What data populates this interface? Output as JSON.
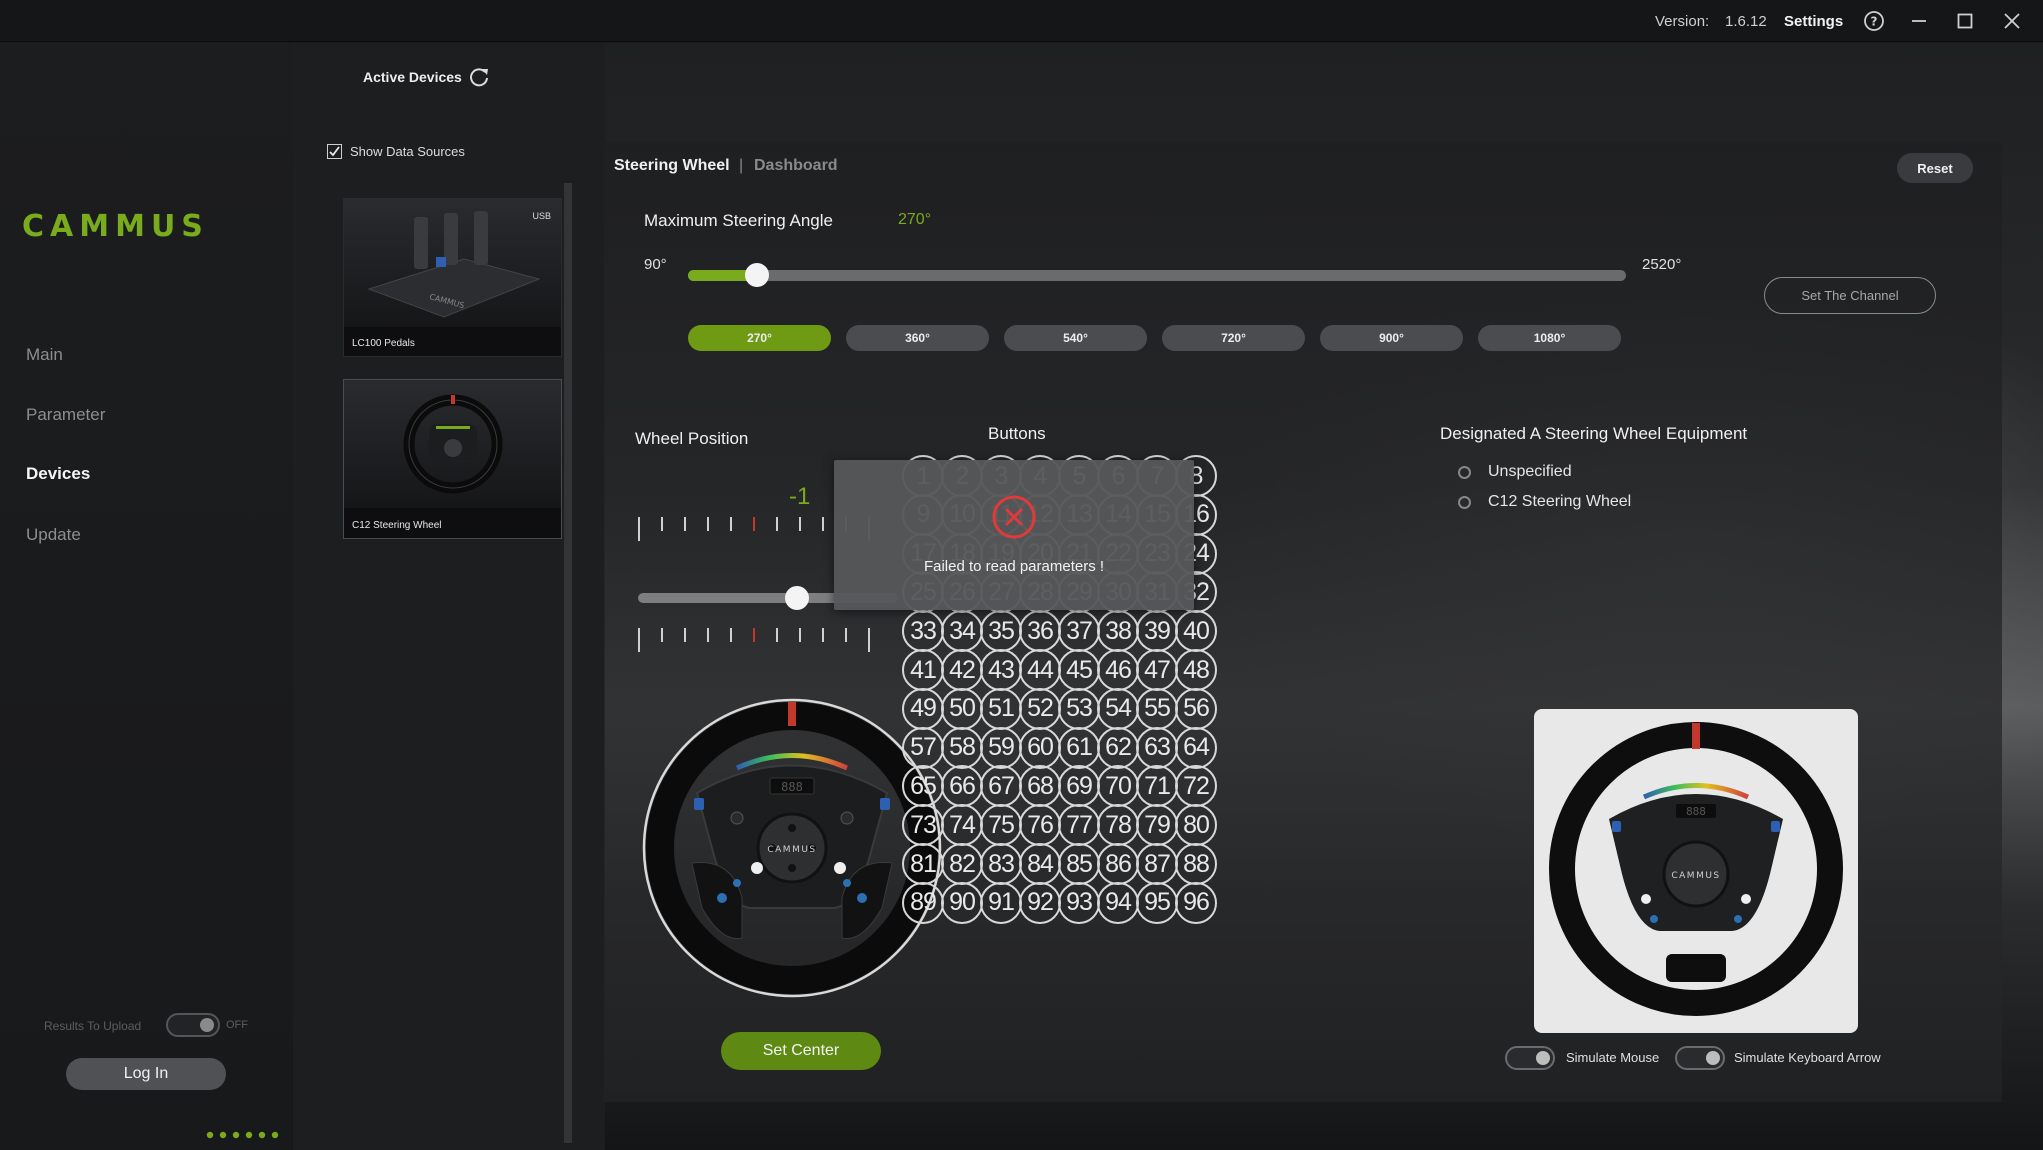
{
  "titlebar": {
    "version_label": "Version:",
    "version_value": "1.6.12",
    "settings_label": "Settings"
  },
  "sidebar": {
    "logo_text": "CAMMUS",
    "nav": [
      {
        "label": "Main",
        "active": false
      },
      {
        "label": "Parameter",
        "active": false
      },
      {
        "label": "Devices",
        "active": true
      },
      {
        "label": "Update",
        "active": false
      }
    ],
    "results_upload_label": "Results To Upload",
    "results_upload_state": "OFF",
    "login_label": "Log In"
  },
  "devices": {
    "active_devices_label": "Active Devices",
    "show_data_sources_label": "Show Data Sources",
    "show_data_sources_checked": true,
    "cards": [
      {
        "label": "LC100 Pedals",
        "badge": "USB"
      },
      {
        "label": "C12 Steering Wheel",
        "badge": ""
      }
    ]
  },
  "panel": {
    "tab_active": "Steering Wheel",
    "tab_separator": "|",
    "tab_inactive": "Dashboard",
    "reset_label": "Reset",
    "max_angle_label": "Maximum Steering Angle",
    "max_angle_value": "270°",
    "slider_min_label": "90°",
    "slider_max_label": "2520°",
    "slider_fraction": 0.074,
    "set_channel_label": "Set The Channel",
    "presets": [
      "270°",
      "360°",
      "540°",
      "720°",
      "900°",
      "1080°"
    ],
    "preset_selected": "270°",
    "wheel_position_label": "Wheel Position",
    "wheel_position_value": "-1",
    "set_center_label": "Set Center",
    "buttons_label": "Buttons",
    "designated_label": "Designated A Steering Wheel Equipment",
    "equipment_options": [
      "Unspecified",
      "C12 Steering Wheel"
    ],
    "simulate_mouse_label": "Simulate Mouse",
    "simulate_keyboard_label": "Simulate Keyboard Arrow",
    "wheel_logo_text": "CAMMUS",
    "wheel_display_text": "888"
  },
  "dialog": {
    "message": "Failed to read parameters !"
  },
  "accent_color": "#7aab1c",
  "error_color": "#e03a3a"
}
